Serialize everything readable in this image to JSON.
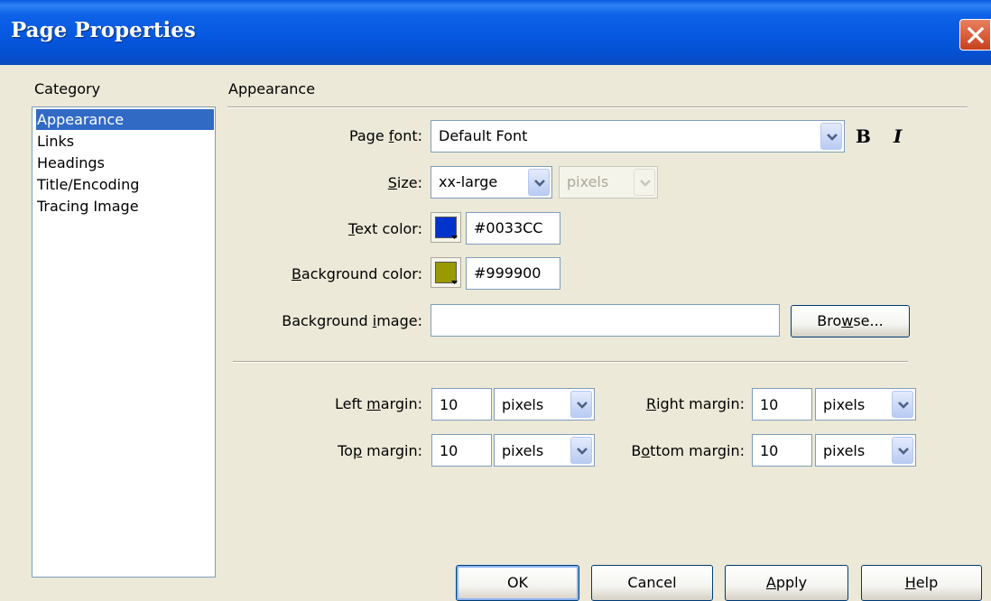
{
  "window": {
    "title": "Page Properties"
  },
  "category": {
    "label": "Category",
    "items": [
      {
        "label": "Appearance",
        "selected": true
      },
      {
        "label": "Links",
        "selected": false
      },
      {
        "label": "Headings",
        "selected": false
      },
      {
        "label": "Title/Encoding",
        "selected": false
      },
      {
        "label": "Tracing Image",
        "selected": false
      }
    ]
  },
  "panel": {
    "title": "Appearance",
    "page_font": {
      "pre": "Page ",
      "u": "f",
      "post": "ont:",
      "value": "Default Font",
      "bold": "B",
      "italic": "I"
    },
    "size": {
      "u": "S",
      "post": "ize:",
      "value": "xx-large",
      "unit": "pixels"
    },
    "text_color": {
      "u": "T",
      "post": "ext color:",
      "value": "#0033CC",
      "swatch": "#0033CC"
    },
    "background_color": {
      "u": "B",
      "post": "ackground color:",
      "value": "#999900",
      "swatch": "#999900"
    },
    "background_image": {
      "pre": "Background ",
      "u": "i",
      "post": "mage:",
      "value": "",
      "browse_pre": "Bro",
      "browse_u": "w",
      "browse_post": "se..."
    },
    "left_margin": {
      "pre": "Left ",
      "u": "m",
      "post": "argin:",
      "value": "10",
      "unit": "pixels"
    },
    "right_margin": {
      "u": "R",
      "post": "ight margin:",
      "value": "10",
      "unit": "pixels"
    },
    "top_margin": {
      "pre": "To",
      "u": "p",
      "post": " margin:",
      "value": "10",
      "unit": "pixels"
    },
    "bottom_margin": {
      "pre": "B",
      "u": "o",
      "post": "ttom margin:",
      "value": "10",
      "unit": "pixels"
    }
  },
  "buttons": {
    "ok": "OK",
    "cancel": "Cancel",
    "apply_u": "A",
    "apply_post": "pply",
    "help_u": "H",
    "help_post": "elp"
  },
  "colors": {
    "titlebar": "#0558E0",
    "selection": "#316AC5",
    "dialog": "#ECE9D8"
  },
  "icons": [
    "close-icon",
    "chevron-down-icon",
    "swatch-dropdown-icon"
  ]
}
